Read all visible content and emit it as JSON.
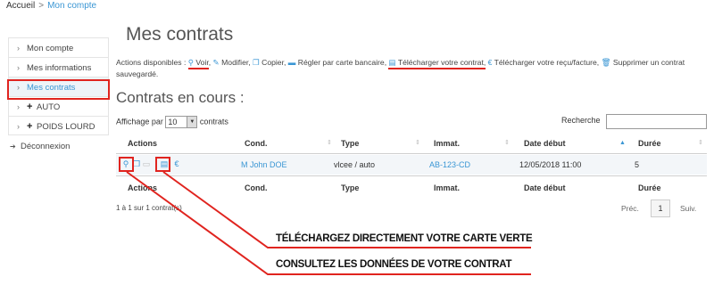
{
  "breadcrumb": {
    "home": "Accueil",
    "separator": ">",
    "current": "Mon compte"
  },
  "sidebar": {
    "items": [
      {
        "label": "Mon compte",
        "prefix": ">"
      },
      {
        "label": "Mes informations",
        "prefix": ">"
      },
      {
        "label": "Mes contrats",
        "prefix": ">"
      },
      {
        "label": "AUTO",
        "prefix": "> +"
      },
      {
        "label": "POIDS LOURD",
        "prefix": "> +"
      }
    ],
    "logout": "Déconnexion"
  },
  "page_title": "Mes contrats",
  "actions_bar": {
    "intro": "Actions disponibles :",
    "voir": "Voir",
    "modifier": "Modifier,",
    "copier": "Copier,",
    "regler": "Régler par carte bancaire,",
    "telecharger_contrat": "Télécharger votre contrat,",
    "telecharger_recu": "Télécharger votre reçu/facture,",
    "supprimer": "Supprimer un contrat sauvegardé."
  },
  "section_title": "Contrats en cours :",
  "table_controls": {
    "show_prefix": "Affichage par",
    "page_size": "10",
    "show_suffix": "contrats",
    "search_label": "Recherche"
  },
  "table": {
    "headers": [
      "Actions",
      "Cond.",
      "Type",
      "Immat.",
      "Date début",
      "Durée"
    ],
    "rows": [
      {
        "cond": "M John DOE",
        "type": "vlcee / auto",
        "immat": "AB-123-CD",
        "date_debut": "12/05/2018 11:00",
        "duree": "5"
      }
    ]
  },
  "table_info": "1 à 1 sur 1 contrat(s)",
  "pagination": {
    "prev": "Préc.",
    "current": "1",
    "next": "Suiv."
  },
  "annotations": {
    "carte_verte": "TÉLÉCHARGEZ DIRECTEMENT VOTRE CARTE VERTE",
    "consultez": "CONSULTEZ LES DONNÉES DE VOTRE CONTRAT"
  },
  "colors": {
    "link": "#3a96d4",
    "highlight": "#e0241f"
  }
}
